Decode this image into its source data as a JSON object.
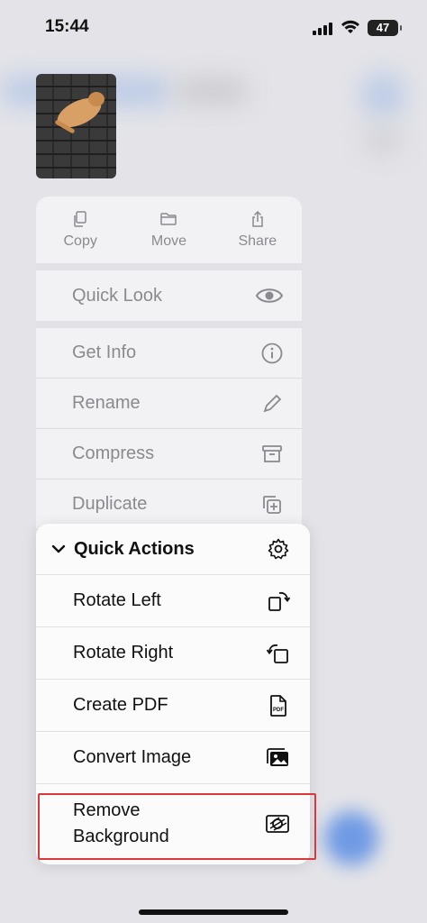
{
  "status_bar": {
    "time": "15:44",
    "battery": "47"
  },
  "thumbnail": {
    "icon": "cat-photo"
  },
  "top_actions": [
    {
      "label": "Copy",
      "icon": "copy-icon"
    },
    {
      "label": "Move",
      "icon": "folder-icon"
    },
    {
      "label": "Share",
      "icon": "share-icon"
    }
  ],
  "menu": {
    "quick_look": "Quick Look",
    "get_info": "Get Info",
    "rename": "Rename",
    "compress": "Compress",
    "duplicate": "Duplicate"
  },
  "quick_actions": {
    "title": "Quick Actions",
    "items": [
      {
        "label": "Rotate Left",
        "icon": "rotate-left-icon"
      },
      {
        "label": "Rotate Right",
        "icon": "rotate-right-icon"
      },
      {
        "label": "Create PDF",
        "icon": "pdf-icon"
      },
      {
        "label": "Convert Image",
        "icon": "convert-image-icon"
      }
    ],
    "remove_background": {
      "line1": "Remove",
      "line2": "Background",
      "icon": "remove-background-icon"
    }
  },
  "colors": {
    "highlight": "#d8383a",
    "menu_background": "#fbfbfc",
    "dimmed_text": "#8a8a8e"
  }
}
